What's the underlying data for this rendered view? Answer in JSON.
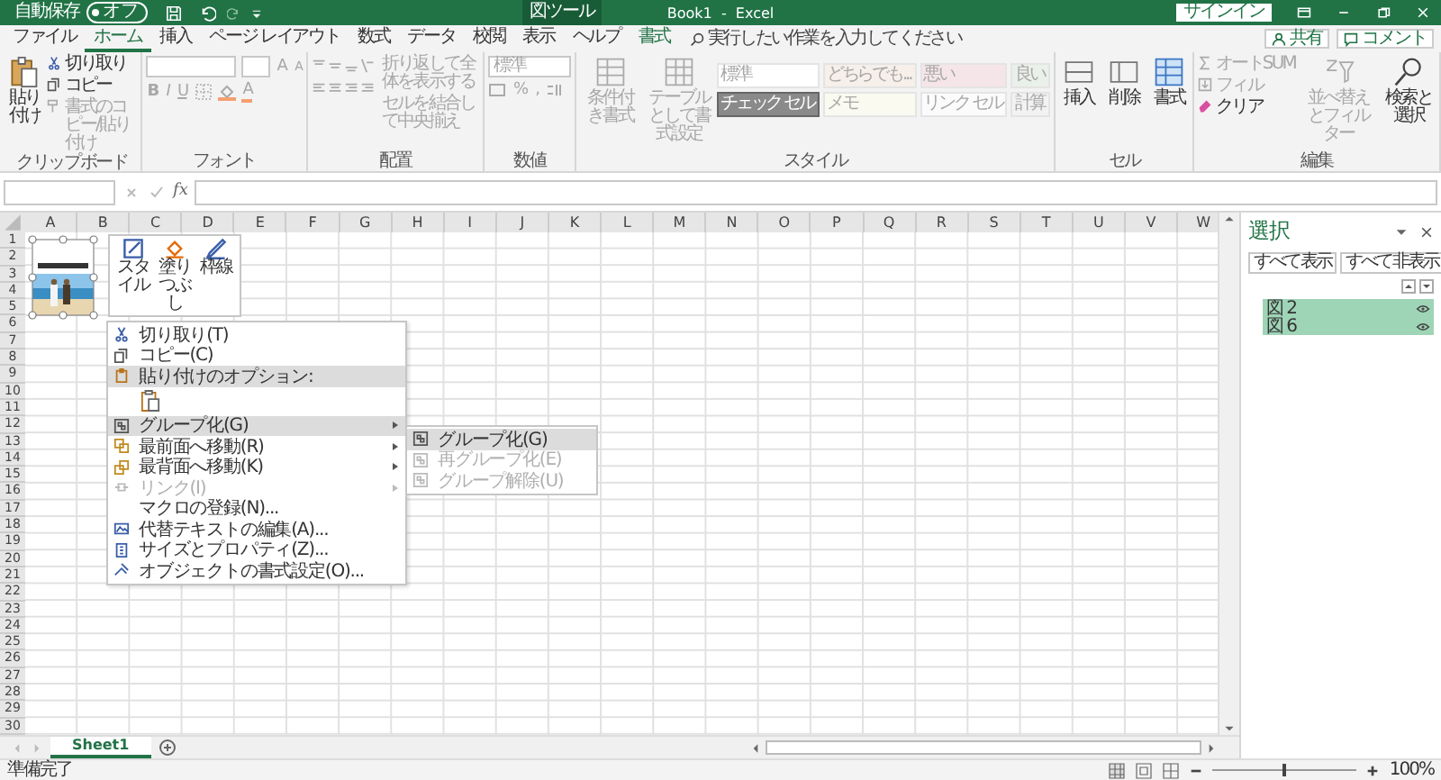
{
  "title_bar": {
    "autosave_label": "自動保存",
    "autosave": {
      "label": "オフ",
      "on": false
    },
    "context_tab": "図ツール",
    "title": "Book1  -  Excel",
    "signin": "サインイン"
  },
  "tabs": [
    {
      "label": "ファイル",
      "selected": false,
      "kind": "normal"
    },
    {
      "label": "ホーム",
      "selected": true,
      "kind": "normal"
    },
    {
      "label": "挿入",
      "selected": false,
      "kind": "normal"
    },
    {
      "label": "ページ レイアウト",
      "selected": false,
      "kind": "normal"
    },
    {
      "label": "数式",
      "selected": false,
      "kind": "normal"
    },
    {
      "label": "データ",
      "selected": false,
      "kind": "normal"
    },
    {
      "label": "校閲",
      "selected": false,
      "kind": "normal"
    },
    {
      "label": "表示",
      "selected": false,
      "kind": "normal"
    },
    {
      "label": "ヘルプ",
      "selected": false,
      "kind": "normal"
    },
    {
      "label": "書式",
      "selected": false,
      "kind": "contextual"
    }
  ],
  "tell_me": {
    "placeholder": "実行したい作業を入力してください"
  },
  "share": "共有",
  "comments": "コメント",
  "ribbon": {
    "clipboard": {
      "paste": {
        "label": "貼り付け",
        "disabled": false
      },
      "cut": {
        "label": "切り取り",
        "disabled": false
      },
      "copy": {
        "label": "コピー",
        "disabled": false
      },
      "format_painter": {
        "label": "書式のコピー/貼り付け",
        "disabled": true
      },
      "label": "クリップボード"
    },
    "font": {
      "disabled": true,
      "grow": "A",
      "shrink": "A",
      "bold": "B",
      "italic": "I",
      "underline": "U",
      "font_color": "A",
      "label": "フォント"
    },
    "alignment": {
      "disabled": true,
      "wrap_text": "折り返して全体を表示する",
      "merge": "セルを結合して中央揃え",
      "label": "配置"
    },
    "number": {
      "disabled": true,
      "format": "標準",
      "percent": "%",
      "comma": ",",
      "label": "数値"
    },
    "styles": {
      "disabled": true,
      "conditional": "条件付き書式",
      "table": "テーブルとして書式設定",
      "label": "スタイル",
      "cell_styles": [
        {
          "label": "標準",
          "kind": "normal"
        },
        {
          "label": "どちらでも...",
          "kind": "neutral"
        },
        {
          "label": "悪い",
          "kind": "bad"
        },
        {
          "label": "良い",
          "kind": "good"
        },
        {
          "label": "チェック セル",
          "kind": "check"
        },
        {
          "label": "メモ",
          "kind": "note"
        },
        {
          "label": "リンク セル",
          "kind": "linked"
        },
        {
          "label": "計算",
          "kind": "calc"
        }
      ]
    },
    "cells": {
      "insert": {
        "label": "挿入",
        "disabled": false
      },
      "delete": {
        "label": "削除",
        "disabled": false
      },
      "format": {
        "label": "書式",
        "disabled": false
      },
      "label": "セル"
    },
    "editing": {
      "autosum": {
        "label": "オートSUM",
        "disabled": true
      },
      "fill": {
        "label": "フィル",
        "disabled": true
      },
      "clear": {
        "label": "クリア",
        "disabled": false
      },
      "sort": {
        "label": "並べ替えとフィルター",
        "disabled": true
      },
      "find": {
        "label": "検索と選択",
        "disabled": false
      },
      "label": "編集"
    }
  },
  "formula_bar": {
    "fx": "fx"
  },
  "columns": [
    "A",
    "B",
    "C",
    "D",
    "E",
    "F",
    "G",
    "H",
    "I",
    "J",
    "K",
    "L",
    "M",
    "N",
    "O",
    "P",
    "Q",
    "R",
    "S",
    "T",
    "U",
    "V",
    "W"
  ],
  "rows": [
    "1",
    "2",
    "3",
    "4",
    "5",
    "6",
    "7",
    "8",
    "9",
    "10",
    "11",
    "12",
    "13",
    "14",
    "15",
    "16",
    "17",
    "18",
    "19",
    "20",
    "21",
    "22",
    "23",
    "24",
    "25",
    "26",
    "27",
    "28",
    "29",
    "30"
  ],
  "mini_toolbar": [
    "スタイル",
    "塗りつぶし",
    "枠線"
  ],
  "context_menu": [
    {
      "kind": "item",
      "label": "切り取り(T)",
      "selected": false,
      "disabled": false,
      "submenu": false
    },
    {
      "kind": "item",
      "label": "コピー(C)",
      "selected": false,
      "disabled": false,
      "submenu": false
    },
    {
      "kind": "header",
      "label": "貼り付けのオプション:",
      "selected": true
    },
    {
      "kind": "paste",
      "selected": false
    },
    {
      "kind": "item",
      "label": "グループ化(G)",
      "selected": true,
      "disabled": false,
      "submenu": true
    },
    {
      "kind": "item",
      "label": "最前面へ移動(R)",
      "selected": false,
      "disabled": false,
      "submenu": true
    },
    {
      "kind": "item",
      "label": "最背面へ移動(K)",
      "selected": false,
      "disabled": false,
      "submenu": true
    },
    {
      "kind": "item",
      "label": "リンク(I)",
      "selected": false,
      "disabled": true,
      "submenu": true
    },
    {
      "kind": "item",
      "label": "マクロの登録(N)...",
      "selected": false,
      "disabled": false,
      "submenu": false
    },
    {
      "kind": "item",
      "label": "代替テキストの編集(A)...",
      "selected": false,
      "disabled": false,
      "submenu": false
    },
    {
      "kind": "item",
      "label": "サイズとプロパティ(Z)...",
      "selected": false,
      "disabled": false,
      "submenu": false
    },
    {
      "kind": "item",
      "label": "オブジェクトの書式設定(O)...",
      "selected": false,
      "disabled": false,
      "submenu": false
    }
  ],
  "submenu": [
    {
      "label": "グループ化(G)",
      "selected": true,
      "disabled": false
    },
    {
      "label": "再グループ化(E)",
      "selected": false,
      "disabled": true
    },
    {
      "label": "グループ解除(U)",
      "selected": false,
      "disabled": true
    }
  ],
  "selection_pane": {
    "title": "選択",
    "show_all": "すべて表示",
    "hide_all": "すべて非表示",
    "items": [
      {
        "label": "図 2",
        "selected": true
      },
      {
        "label": "図 6",
        "selected": true
      }
    ]
  },
  "sheets": [
    {
      "label": "Sheet1",
      "selected": true
    }
  ],
  "status": "準備完了",
  "zoom": {
    "label": "100%",
    "level": 0.5
  }
}
